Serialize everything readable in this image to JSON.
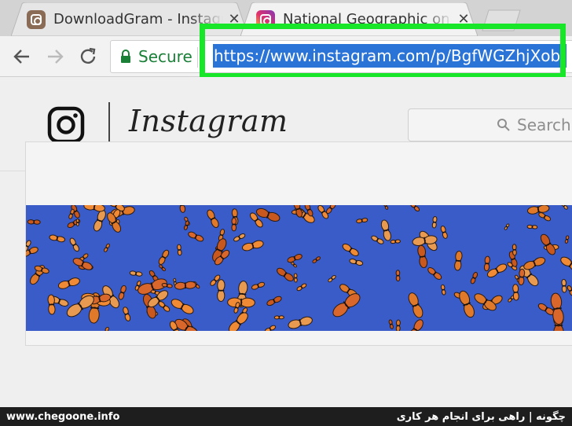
{
  "browser": {
    "tabs": [
      {
        "title": "DownloadGram - Instagram",
        "icon": "instagram-favicon-icon",
        "active": false
      },
      {
        "title": "National Geographic on Instagram",
        "icon": "instagram-favicon-icon",
        "active": true
      }
    ],
    "close_glyph": "✕",
    "secure_label": "Secure",
    "url": "https://www.instagram.com/p/BgfWGZhjXob/",
    "highlight_color": "#18e629"
  },
  "instagram": {
    "wordmark": "Instagram",
    "search_placeholder": "Search"
  },
  "watermark": {
    "site": "www.chegoone.info",
    "tagline": "چگونه | راهی برای انجام هر کاری"
  }
}
